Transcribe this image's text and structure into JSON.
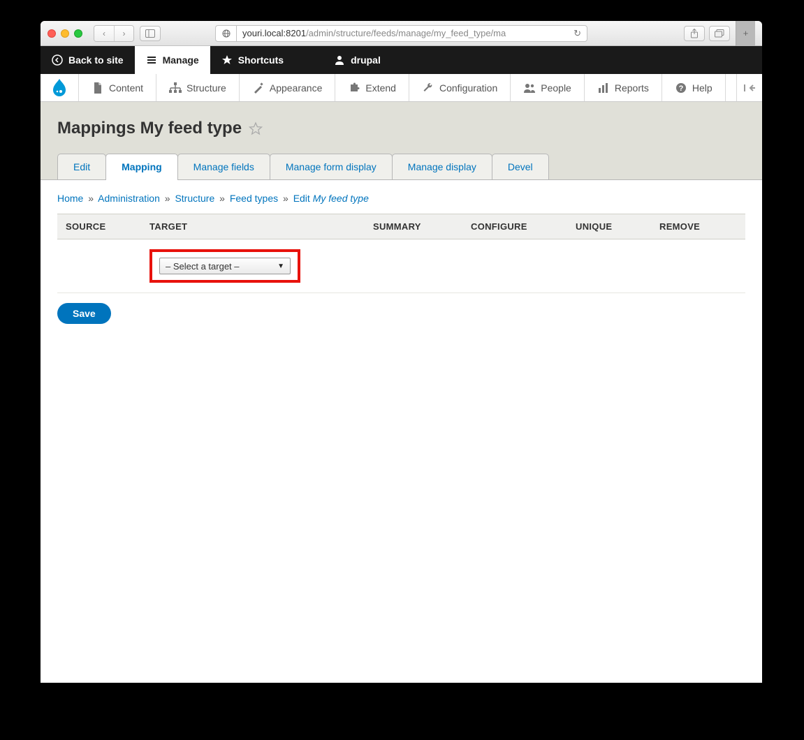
{
  "browser": {
    "url_host": "youri.local:8201",
    "url_path": "/admin/structure/feeds/manage/my_feed_type/ma"
  },
  "black_bar": {
    "back_to_site": "Back to site",
    "manage": "Manage",
    "shortcuts": "Shortcuts",
    "user": "drupal"
  },
  "grey_bar": {
    "content": "Content",
    "structure": "Structure",
    "appearance": "Appearance",
    "extend": "Extend",
    "configuration": "Configuration",
    "people": "People",
    "reports": "Reports",
    "help": "Help"
  },
  "page": {
    "title": "Mappings My feed type"
  },
  "tabs": {
    "edit": "Edit",
    "mapping": "Mapping",
    "manage_fields": "Manage fields",
    "manage_form_display": "Manage form display",
    "manage_display": "Manage display",
    "devel": "Devel"
  },
  "breadcrumb": {
    "home": "Home",
    "admin": "Administration",
    "structure": "Structure",
    "feed_types": "Feed types",
    "edit": "Edit",
    "current": "My feed type"
  },
  "table": {
    "headers": {
      "source": "SOURCE",
      "target": "TARGET",
      "summary": "SUMMARY",
      "configure": "CONFIGURE",
      "unique": "UNIQUE",
      "remove": "REMOVE"
    },
    "select_placeholder": "– Select a target –"
  },
  "actions": {
    "save": "Save"
  }
}
